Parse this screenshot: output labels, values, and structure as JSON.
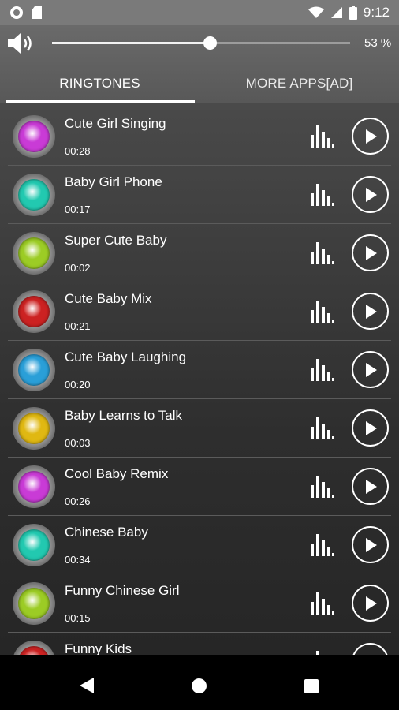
{
  "status_bar": {
    "time": "9:12",
    "icons": [
      "record-icon",
      "sd-card-icon",
      "wifi-icon",
      "signal-icon",
      "battery-icon"
    ]
  },
  "volume": {
    "icon": "speaker-icon",
    "level_fraction": 0.53,
    "percent_text": "53 %"
  },
  "tabs": [
    {
      "label": "RINGTONES",
      "active": true
    },
    {
      "label": "MORE APPS[AD]",
      "active": false
    }
  ],
  "ringtones": [
    {
      "title": "Cute Girl Singing",
      "duration": "00:28",
      "color": "#c93bd6"
    },
    {
      "title": "Baby Girl Phone",
      "duration": "00:17",
      "color": "#22c9b0"
    },
    {
      "title": "Super Cute Baby",
      "duration": "00:02",
      "color": "#9ccc25"
    },
    {
      "title": "Cute Baby Mix",
      "duration": "00:21",
      "color": "#cc2222"
    },
    {
      "title": "Cute Baby Laughing",
      "duration": "00:20",
      "color": "#2a9fd8"
    },
    {
      "title": "Baby Learns to Talk",
      "duration": "00:03",
      "color": "#e0b812"
    },
    {
      "title": "Cool Baby Remix",
      "duration": "00:26",
      "color": "#c93bd6"
    },
    {
      "title": "Chinese Baby",
      "duration": "00:34",
      "color": "#22c9b0"
    },
    {
      "title": "Funny Chinese Girl",
      "duration": "00:15",
      "color": "#9ccc25"
    },
    {
      "title": "Funny Kids",
      "duration": "",
      "color": "#cc2222"
    }
  ],
  "nav_bar": {
    "icons": [
      "back-icon",
      "home-icon",
      "recent-apps-icon"
    ]
  }
}
